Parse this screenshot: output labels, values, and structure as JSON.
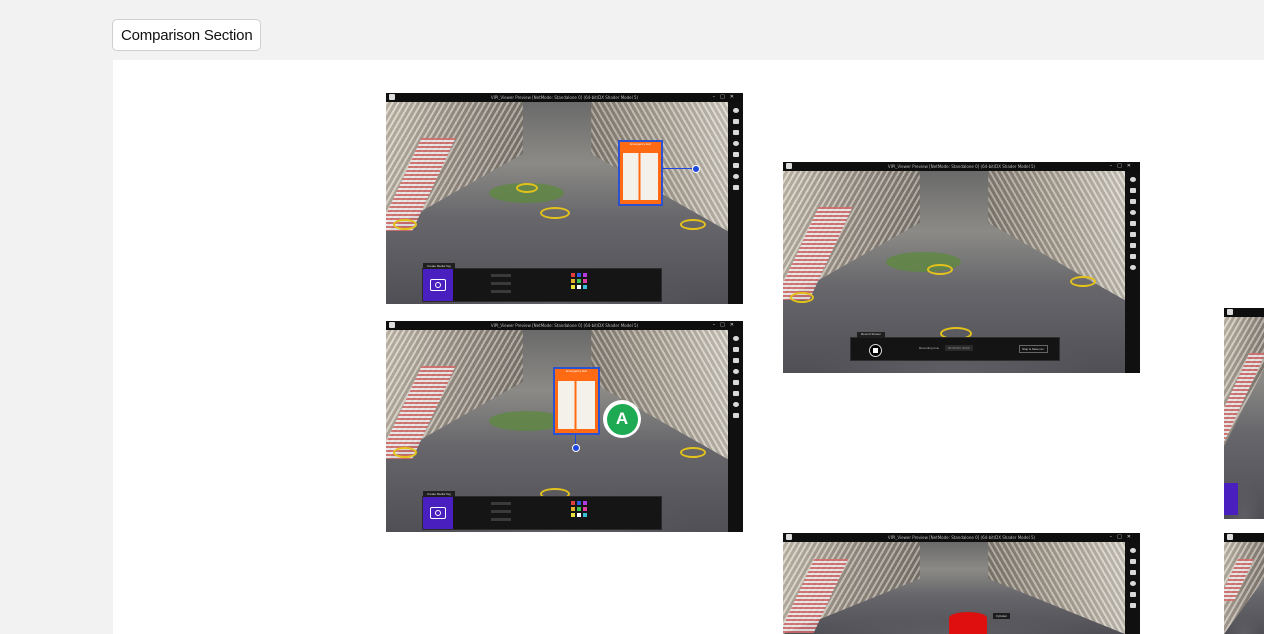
{
  "section": {
    "label": "Comparison Section"
  },
  "frames": {
    "title": "VIPI_Viewer Preview [NetMode: Standalone 0] (64-bit/DX Shader Model 5)"
  },
  "media_tag_panel": {
    "title": "Create Media Tag",
    "setting": "Setting",
    "type": "Type",
    "source": "Source",
    "show_icon": "Show Icon",
    "remove_background": "Remove Background",
    "set_appear": "Set Appear",
    "select_color": "Select color for text/icon",
    "back": "Back"
  },
  "safety_sign": {
    "title": "Emergency Exit"
  },
  "badge": {
    "letter": "A"
  },
  "record_panel": {
    "title": "Record Screen",
    "recording_time_label": "Recording time",
    "recording_time_value": "00:00:00 | 00:00",
    "save_button": "Stop & Save rec."
  },
  "cylinder_tag": {
    "label": "Cylinder"
  },
  "colors": {
    "ring": "#e3c21b",
    "camera_tile": "#4a1fbf",
    "safety_orange": "#ff6a13",
    "pin_blue": "#1d46e0",
    "badge_green": "#1eaa52",
    "cylinder_red": "#e00f0f"
  }
}
